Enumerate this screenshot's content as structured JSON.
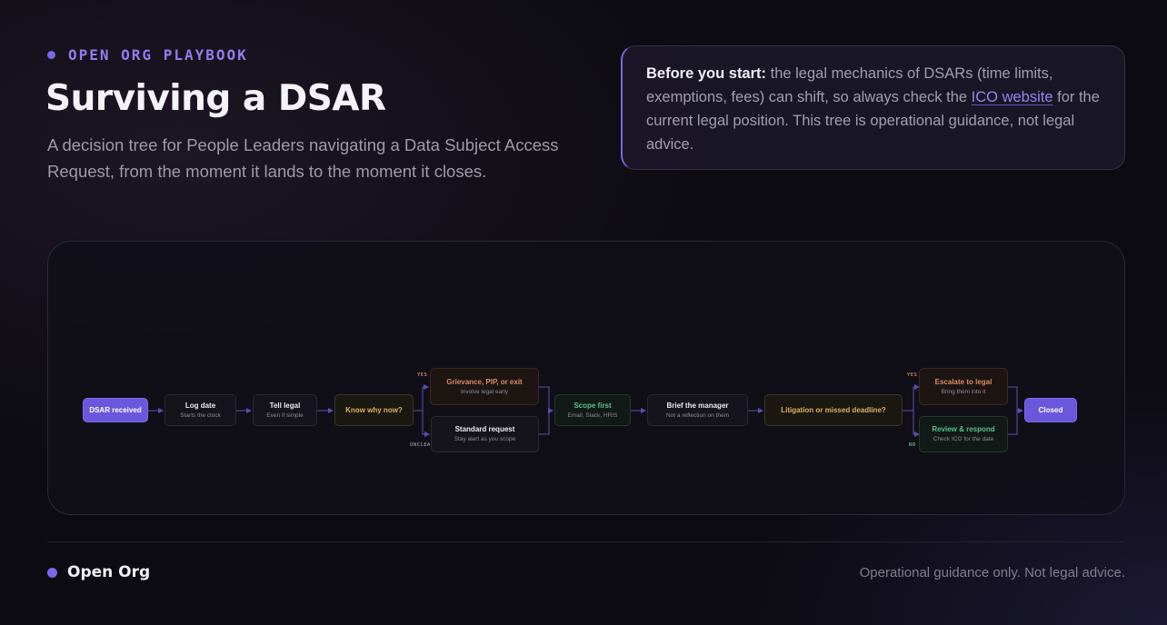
{
  "header": {
    "eyebrow": "OPEN ORG PLAYBOOK",
    "title": "Surviving a DSAR",
    "subtitle": "A decision tree for People Leaders navigating a Data Subject Access Request, from the moment it lands to the moment it closes."
  },
  "notice": {
    "lead": "Before you start:",
    "text_before_link": " the legal mechanics of DSARs (time limits, exemptions, fees) can shift, so always check the ",
    "link_text": "ICO website",
    "text_after_link": " for the current legal position. This tree is operational guidance, not legal advice."
  },
  "tree": {
    "nodes": {
      "dsar_received": {
        "title": "DSAR received"
      },
      "log_date": {
        "title": "Log date",
        "sub": "Starts the clock"
      },
      "tell_legal": {
        "title": "Tell legal",
        "sub": "Even if simple"
      },
      "know_why": {
        "title": "Know why now?"
      },
      "grievance": {
        "title": "Grievance, PIP, or exit",
        "sub": "Involve legal early"
      },
      "standard": {
        "title": "Standard request",
        "sub": "Stay alert as you scope"
      },
      "scope_first": {
        "title": "Scope first",
        "sub": "Email, Slack, HRIS"
      },
      "brief_manager": {
        "title": "Brief the manager",
        "sub": "Not a reflection on them"
      },
      "litigation": {
        "title": "Litigation or missed deadline?"
      },
      "escalate": {
        "title": "Escalate to legal",
        "sub": "Bring them into it"
      },
      "review": {
        "title": "Review & respond",
        "sub": "Check ICO for the date"
      },
      "closed": {
        "title": "Closed"
      }
    },
    "branches": {
      "know_yes": "YES",
      "know_unclear": "UNCLEAR",
      "lit_yes": "YES",
      "lit_no": "NO"
    }
  },
  "footer": {
    "brand": "Open Org",
    "disclaimer": "Operational guidance only. Not legal advice."
  },
  "colors": {
    "accent": "#7a67e6",
    "decision": "#d8b25e",
    "warning": "#dc8c66",
    "success": "#56c08e",
    "connector": "#5a4fb0"
  }
}
